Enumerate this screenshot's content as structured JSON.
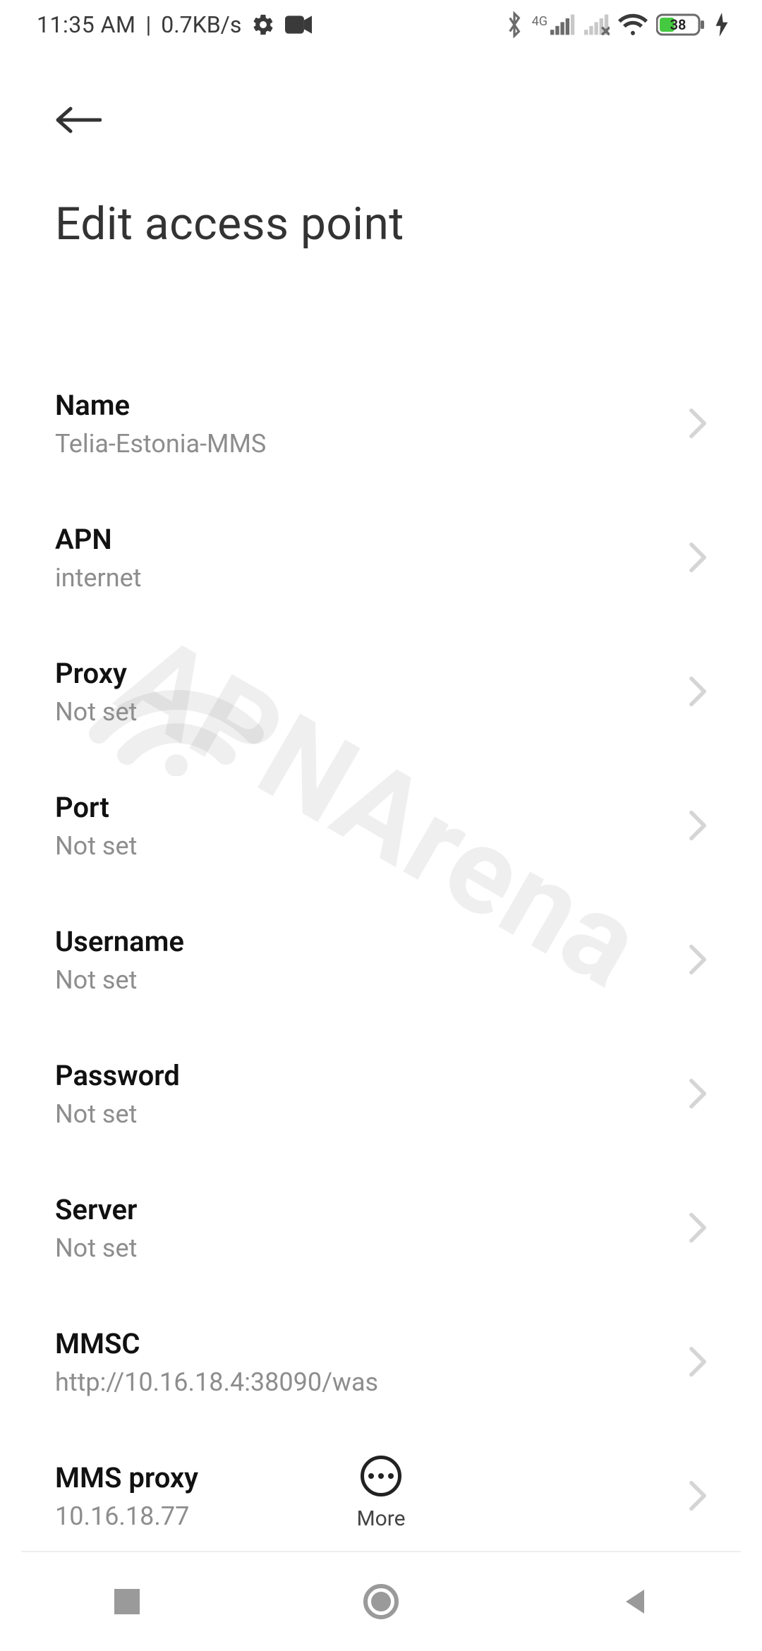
{
  "status_bar": {
    "time": "11:35 AM",
    "separator": "|",
    "data_rate": "0.7KB/s",
    "network_badge": "4G",
    "battery_percent": "38"
  },
  "header": {
    "title": "Edit access point"
  },
  "settings": [
    {
      "label": "Name",
      "value": "Telia-Estonia-MMS"
    },
    {
      "label": "APN",
      "value": "internet"
    },
    {
      "label": "Proxy",
      "value": "Not set"
    },
    {
      "label": "Port",
      "value": "Not set"
    },
    {
      "label": "Username",
      "value": "Not set"
    },
    {
      "label": "Password",
      "value": "Not set"
    },
    {
      "label": "Server",
      "value": "Not set"
    },
    {
      "label": "MMSC",
      "value": "http://10.16.18.4:38090/was"
    },
    {
      "label": "MMS proxy",
      "value": "10.16.18.77"
    }
  ],
  "bottom_action": {
    "label": "More"
  },
  "watermark": {
    "text": "APNArena"
  }
}
